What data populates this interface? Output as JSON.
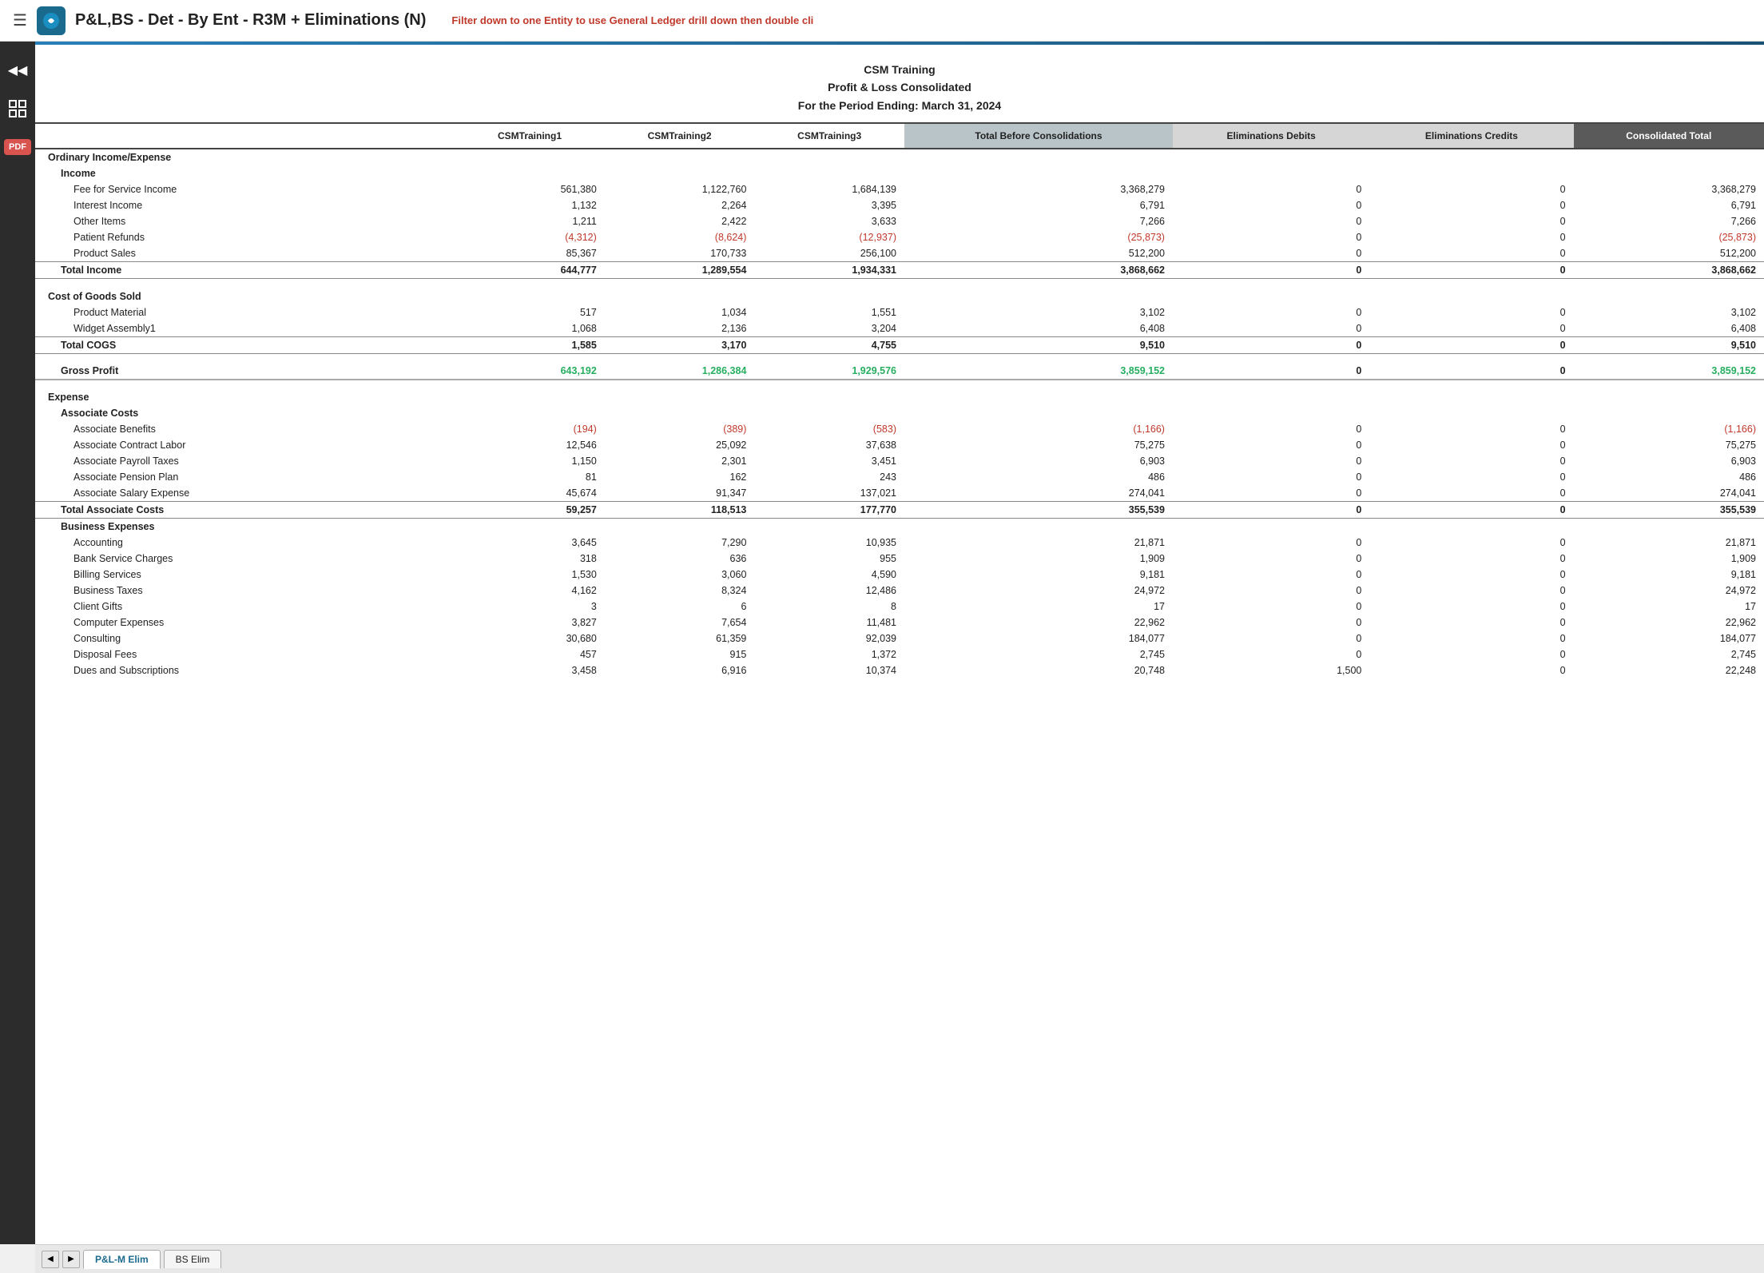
{
  "topbar": {
    "title": "P&L,BS - Det - By Ent - R3M + Eliminations (N)",
    "filter_text": "Filter down to one ",
    "filter_entity": "Entity",
    "filter_suffix": " to use General Ledger drill down then double cli"
  },
  "report": {
    "company": "CSM Training",
    "report_name": "Profit & Loss Consolidated",
    "period": "For the Period Ending: March 31, 2024",
    "columns": {
      "label": "",
      "col1": "CSMTraining1",
      "col2": "CSMTraining2",
      "col3": "CSMTraining3",
      "col4": "Total Before Consolidations",
      "col5": "Eliminations Debits",
      "col6": "Eliminations Credits",
      "col7": "Consolidated Total"
    },
    "sections": [
      {
        "type": "section-header",
        "label": "Ordinary Income/Expense",
        "col1": "",
        "col2": "",
        "col3": "",
        "col4": "",
        "col5": "",
        "col6": "",
        "col7": ""
      },
      {
        "type": "subsection-header",
        "label": "Income",
        "col1": "",
        "col2": "",
        "col3": "",
        "col4": "",
        "col5": "",
        "col6": "",
        "col7": ""
      },
      {
        "type": "data",
        "label": "Fee for Service Income",
        "col1": "561,380",
        "col2": "1,122,760",
        "col3": "1,684,139",
        "col4": "3,368,279",
        "col5": "0",
        "col6": "0",
        "col7": "3,368,279"
      },
      {
        "type": "data",
        "label": "Interest Income",
        "col1": "1,132",
        "col2": "2,264",
        "col3": "3,395",
        "col4": "6,791",
        "col5": "0",
        "col6": "0",
        "col7": "6,791"
      },
      {
        "type": "data",
        "label": "Other Items",
        "col1": "1,211",
        "col2": "2,422",
        "col3": "3,633",
        "col4": "7,266",
        "col5": "0",
        "col6": "0",
        "col7": "7,266"
      },
      {
        "type": "data",
        "label": "Patient Refunds",
        "col1": "(4,312)",
        "col2": "(8,624)",
        "col3": "(12,937)",
        "col4": "(25,873)",
        "col5": "0",
        "col6": "0",
        "col7": "(25,873)",
        "neg": true
      },
      {
        "type": "data",
        "label": "Product Sales",
        "col1": "85,367",
        "col2": "170,733",
        "col3": "256,100",
        "col4": "512,200",
        "col5": "0",
        "col6": "0",
        "col7": "512,200"
      },
      {
        "type": "total",
        "label": "Total Income",
        "col1": "644,777",
        "col2": "1,289,554",
        "col3": "1,934,331",
        "col4": "3,868,662",
        "col5": "0",
        "col6": "0",
        "col7": "3,868,662"
      },
      {
        "type": "spacer"
      },
      {
        "type": "section-header",
        "label": "Cost of Goods Sold",
        "col1": "",
        "col2": "",
        "col3": "",
        "col4": "",
        "col5": "",
        "col6": "",
        "col7": ""
      },
      {
        "type": "data",
        "label": "Product Material",
        "col1": "517",
        "col2": "1,034",
        "col3": "1,551",
        "col4": "3,102",
        "col5": "0",
        "col6": "0",
        "col7": "3,102"
      },
      {
        "type": "data",
        "label": "Widget Assembly1",
        "col1": "1,068",
        "col2": "2,136",
        "col3": "3,204",
        "col4": "6,408",
        "col5": "0",
        "col6": "0",
        "col7": "6,408"
      },
      {
        "type": "total",
        "label": "Total COGS",
        "col1": "1,585",
        "col2": "3,170",
        "col3": "4,755",
        "col4": "9,510",
        "col5": "0",
        "col6": "0",
        "col7": "9,510"
      },
      {
        "type": "spacer"
      },
      {
        "type": "gross-profit",
        "label": "Gross Profit",
        "col1": "643,192",
        "col2": "1,286,384",
        "col3": "1,929,576",
        "col4": "3,859,152",
        "col5": "0",
        "col6": "0",
        "col7": "3,859,152",
        "green": true
      },
      {
        "type": "spacer"
      },
      {
        "type": "section-header",
        "label": "Expense",
        "col1": "",
        "col2": "",
        "col3": "",
        "col4": "",
        "col5": "",
        "col6": "",
        "col7": ""
      },
      {
        "type": "subsection-header",
        "label": "Associate Costs",
        "col1": "",
        "col2": "",
        "col3": "",
        "col4": "",
        "col5": "",
        "col6": "",
        "col7": ""
      },
      {
        "type": "data",
        "label": "Associate Benefits",
        "col1": "(194)",
        "col2": "(389)",
        "col3": "(583)",
        "col4": "(1,166)",
        "col5": "0",
        "col6": "0",
        "col7": "(1,166)",
        "neg": true
      },
      {
        "type": "data",
        "label": "Associate Contract Labor",
        "col1": "12,546",
        "col2": "25,092",
        "col3": "37,638",
        "col4": "75,275",
        "col5": "0",
        "col6": "0",
        "col7": "75,275"
      },
      {
        "type": "data",
        "label": "Associate Payroll Taxes",
        "col1": "1,150",
        "col2": "2,301",
        "col3": "3,451",
        "col4": "6,903",
        "col5": "0",
        "col6": "0",
        "col7": "6,903"
      },
      {
        "type": "data",
        "label": "Associate Pension Plan",
        "col1": "81",
        "col2": "162",
        "col3": "243",
        "col4": "486",
        "col5": "0",
        "col6": "0",
        "col7": "486"
      },
      {
        "type": "data",
        "label": "Associate Salary Expense",
        "col1": "45,674",
        "col2": "91,347",
        "col3": "137,021",
        "col4": "274,041",
        "col5": "0",
        "col6": "0",
        "col7": "274,041"
      },
      {
        "type": "total",
        "label": "Total Associate Costs",
        "col1": "59,257",
        "col2": "118,513",
        "col3": "177,770",
        "col4": "355,539",
        "col5": "0",
        "col6": "0",
        "col7": "355,539"
      },
      {
        "type": "subsection-header",
        "label": "Business Expenses",
        "col1": "",
        "col2": "",
        "col3": "",
        "col4": "",
        "col5": "",
        "col6": "",
        "col7": ""
      },
      {
        "type": "data",
        "label": "Accounting",
        "col1": "3,645",
        "col2": "7,290",
        "col3": "10,935",
        "col4": "21,871",
        "col5": "0",
        "col6": "0",
        "col7": "21,871"
      },
      {
        "type": "data",
        "label": "Bank Service Charges",
        "col1": "318",
        "col2": "636",
        "col3": "955",
        "col4": "1,909",
        "col5": "0",
        "col6": "0",
        "col7": "1,909"
      },
      {
        "type": "data",
        "label": "Billing Services",
        "col1": "1,530",
        "col2": "3,060",
        "col3": "4,590",
        "col4": "9,181",
        "col5": "0",
        "col6": "0",
        "col7": "9,181"
      },
      {
        "type": "data",
        "label": "Business Taxes",
        "col1": "4,162",
        "col2": "8,324",
        "col3": "12,486",
        "col4": "24,972",
        "col5": "0",
        "col6": "0",
        "col7": "24,972"
      },
      {
        "type": "data",
        "label": "Client Gifts",
        "col1": "3",
        "col2": "6",
        "col3": "8",
        "col4": "17",
        "col5": "0",
        "col6": "0",
        "col7": "17"
      },
      {
        "type": "data",
        "label": "Computer Expenses",
        "col1": "3,827",
        "col2": "7,654",
        "col3": "11,481",
        "col4": "22,962",
        "col5": "0",
        "col6": "0",
        "col7": "22,962"
      },
      {
        "type": "data",
        "label": "Consulting",
        "col1": "30,680",
        "col2": "61,359",
        "col3": "92,039",
        "col4": "184,077",
        "col5": "0",
        "col6": "0",
        "col7": "184,077"
      },
      {
        "type": "data",
        "label": "Disposal Fees",
        "col1": "457",
        "col2": "915",
        "col3": "1,372",
        "col4": "2,745",
        "col5": "0",
        "col6": "0",
        "col7": "2,745"
      },
      {
        "type": "data",
        "label": "Dues and Subscriptions",
        "col1": "3,458",
        "col2": "6,916",
        "col3": "10,374",
        "col4": "20,748",
        "col5": "1,500",
        "col6": "0",
        "col7": "22,248"
      }
    ]
  },
  "tabs": {
    "active": "P&L-M Elim",
    "items": [
      "P&L-M Elim",
      "BS Elim"
    ]
  },
  "sidebar": {
    "icons": [
      {
        "name": "rewind-icon",
        "symbol": "◀◀"
      },
      {
        "name": "grid-icon",
        "symbol": "▦"
      },
      {
        "name": "pdf-icon",
        "symbol": "PDF"
      }
    ]
  }
}
